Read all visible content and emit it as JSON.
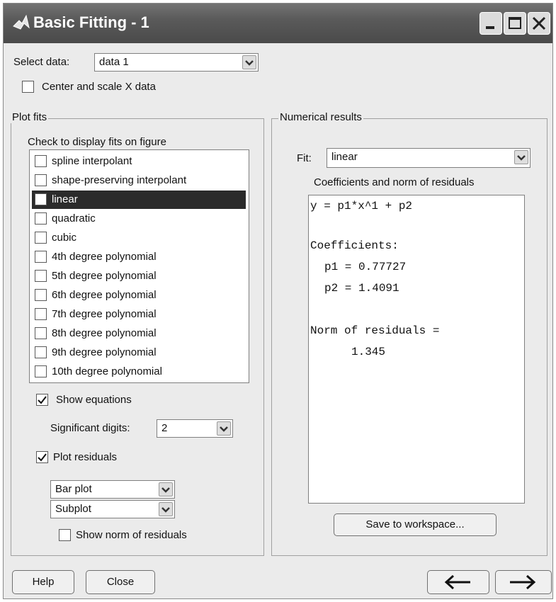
{
  "window": {
    "title": "Basic Fitting - 1"
  },
  "icons": {
    "app": "matlab-logo-icon",
    "minimize": "minimize-icon",
    "maximize": "maximize-icon",
    "close": "close-icon",
    "dropdown": "chevron-down-icon",
    "check": "checkmark-icon",
    "back": "arrow-left-icon",
    "forward": "arrow-right-icon"
  },
  "select_data": {
    "label": "Select data:",
    "value": "data 1"
  },
  "center_scale": {
    "label": "Center and scale X data",
    "checked": false
  },
  "plot_fits": {
    "title": "Plot fits",
    "instruction": "Check to display fits on figure",
    "items": [
      {
        "label": "spline interpolant",
        "checked": false,
        "selected": false
      },
      {
        "label": "shape-preserving interpolant",
        "checked": false,
        "selected": false
      },
      {
        "label": "linear",
        "checked": false,
        "selected": true
      },
      {
        "label": "quadratic",
        "checked": false,
        "selected": false
      },
      {
        "label": "cubic",
        "checked": false,
        "selected": false
      },
      {
        "label": "4th degree polynomial",
        "checked": false,
        "selected": false
      },
      {
        "label": "5th degree polynomial",
        "checked": false,
        "selected": false
      },
      {
        "label": "6th degree polynomial",
        "checked": false,
        "selected": false
      },
      {
        "label": "7th degree polynomial",
        "checked": false,
        "selected": false
      },
      {
        "label": "8th degree polynomial",
        "checked": false,
        "selected": false
      },
      {
        "label": "9th degree polynomial",
        "checked": false,
        "selected": false
      },
      {
        "label": "10th degree polynomial",
        "checked": false,
        "selected": false
      }
    ],
    "show_equations": {
      "label": "Show equations",
      "checked": true
    },
    "significant_digits": {
      "label": "Significant digits:",
      "value": "2"
    },
    "plot_residuals": {
      "label": "Plot residuals",
      "checked": true
    },
    "residual_plot_type": "Bar plot",
    "residual_plot_location": "Subplot",
    "show_norm": {
      "label": "Show norm of residuals",
      "checked": false
    }
  },
  "numerical_results": {
    "title": "Numerical results",
    "fit_label": "Fit:",
    "fit_value": "linear",
    "subtitle": "Coefficients and norm of residuals",
    "lines": {
      "equation": "y = p1*x^1 + p2",
      "coef_heading": "Coefficients:",
      "p1": "p1 = 0.77727",
      "p2": "p2 = 1.4091",
      "norm_heading": "Norm of residuals =",
      "norm_value": "1.345"
    },
    "save_button": "Save to workspace..."
  },
  "footer": {
    "help": "Help",
    "close": "Close",
    "back": "←",
    "forward": "→"
  }
}
